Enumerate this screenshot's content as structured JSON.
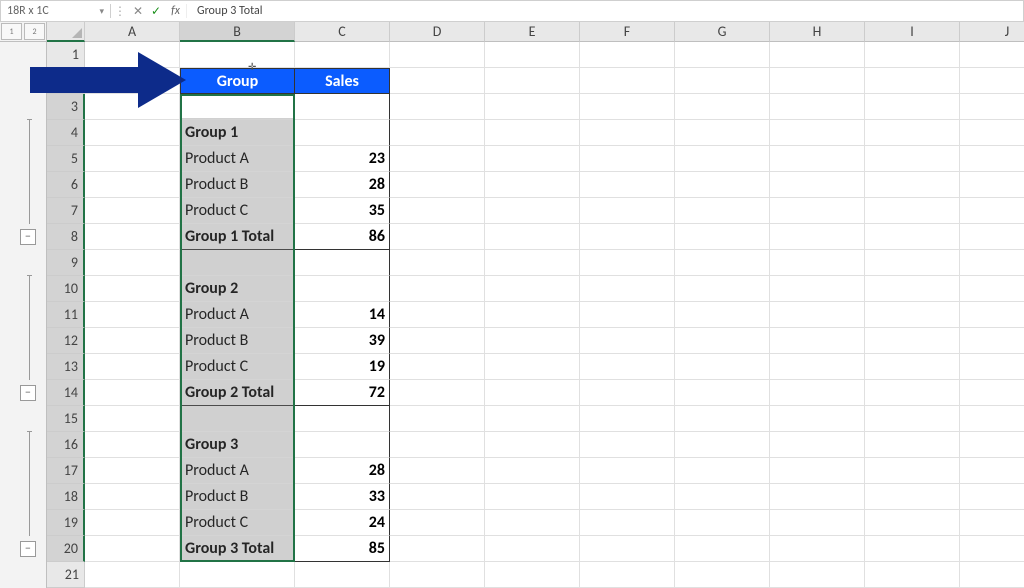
{
  "formula_bar": {
    "name_box": "18R x 1C",
    "content": "Group 3 Total",
    "cancel": "✕",
    "enter": "✓",
    "fx": "fx"
  },
  "columns": [
    "A",
    "B",
    "C",
    "D",
    "E",
    "F",
    "G",
    "H",
    "I",
    "J"
  ],
  "outline_levels": [
    "1",
    "2"
  ],
  "collapse_symbol": "−",
  "cursor": "✛",
  "rows": [
    {
      "n": 1,
      "b": "",
      "c": "",
      "style": "empty"
    },
    {
      "n": 2,
      "b": "Group",
      "c": "Sales",
      "style": "header"
    },
    {
      "n": 3,
      "b": "",
      "c": "",
      "style": "blank"
    },
    {
      "n": 4,
      "b": "Group 1",
      "c": "",
      "style": "ghead",
      "line_start": true
    },
    {
      "n": 5,
      "b": "Product A",
      "c": "23",
      "style": "item",
      "line": true
    },
    {
      "n": 6,
      "b": "Product B",
      "c": "28",
      "style": "item",
      "line": true
    },
    {
      "n": 7,
      "b": "Product C",
      "c": "35",
      "style": "item",
      "line": true
    },
    {
      "n": 8,
      "b": "Group 1 Total",
      "c": "86",
      "style": "total",
      "collapse": true
    },
    {
      "n": 9,
      "b": "",
      "c": "",
      "style": "blank"
    },
    {
      "n": 10,
      "b": "Group 2",
      "c": "",
      "style": "ghead",
      "line_start": true
    },
    {
      "n": 11,
      "b": "Product A",
      "c": "14",
      "style": "item",
      "line": true
    },
    {
      "n": 12,
      "b": "Product B",
      "c": "39",
      "style": "item",
      "line": true
    },
    {
      "n": 13,
      "b": "Product C",
      "c": "19",
      "style": "item",
      "line": true
    },
    {
      "n": 14,
      "b": "Group 2 Total",
      "c": "72",
      "style": "total",
      "collapse": true
    },
    {
      "n": 15,
      "b": "",
      "c": "",
      "style": "blank"
    },
    {
      "n": 16,
      "b": "Group 3",
      "c": "",
      "style": "ghead",
      "line_start": true
    },
    {
      "n": 17,
      "b": "Product A",
      "c": "28",
      "style": "item",
      "line": true
    },
    {
      "n": 18,
      "b": "Product B",
      "c": "33",
      "style": "item",
      "line": true
    },
    {
      "n": 19,
      "b": "Product C",
      "c": "24",
      "style": "item",
      "line": true
    },
    {
      "n": 20,
      "b": "Group 3 Total",
      "c": "85",
      "style": "total",
      "collapse": true
    },
    {
      "n": 21,
      "b": "",
      "c": "",
      "style": "empty"
    }
  ]
}
